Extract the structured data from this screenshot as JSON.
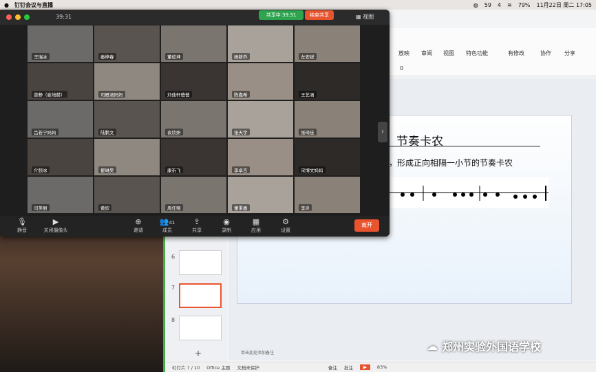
{
  "menubar": {
    "app_name": "钉钉会议与直播",
    "counter": "59",
    "ipad_count": "4",
    "battery": "79%",
    "datetime": "11月22日 周二  17:05"
  },
  "meeting": {
    "elapsed": "39:31",
    "share_label": "共享中 39:31",
    "stop_share": "结束共享",
    "view_label": "视图",
    "members_count": "41",
    "participants": [
      "王瑞冰",
      "秦梓春",
      "董屹坤",
      "杨新乔",
      "左安锐",
      "曾静（崔培赫）",
      "司雁涵妈妈",
      "刘佳轩爸爸",
      "陈嘉希",
      "王艺涵",
      "吕若宁妈妈",
      "陆鹏文",
      "袁欣妍",
      "张天宇",
      "张琦佳",
      "介颐冰",
      "翟琳昊",
      "康祈飞",
      "李卓言",
      "宋博文妈妈",
      "闫美丽",
      "黄欣",
      "周任翔",
      "董秉嘉",
      "李炎"
    ],
    "toolbar": {
      "mute": "静音",
      "camera": "关闭摄像头",
      "invite": "邀请",
      "members": "成员",
      "share": "共享",
      "record": "录制",
      "apps": "应用",
      "settings": "设置",
      "leave": "离开"
    }
  },
  "wps": {
    "ribbon": [
      "放映",
      "审阅",
      "视图",
      "特色功能",
      "有修改",
      "协作",
      "分享"
    ],
    "font_size_value": "0",
    "slide_numbers": [
      "6",
      "7",
      "8"
    ],
    "slide_title": "节奏卡农",
    "slide_body": "，形成正向相隔一小节的节奏卡农",
    "notes_placeholder": "单击此处添加备注",
    "status": {
      "slide_indicator": "幻灯片 7 / 10",
      "theme": "Office 主题",
      "protect": "文档未保护",
      "notes": "备注",
      "comments": "批注",
      "zoom": "83%"
    }
  },
  "watermark": "郑州实验外国语学校"
}
